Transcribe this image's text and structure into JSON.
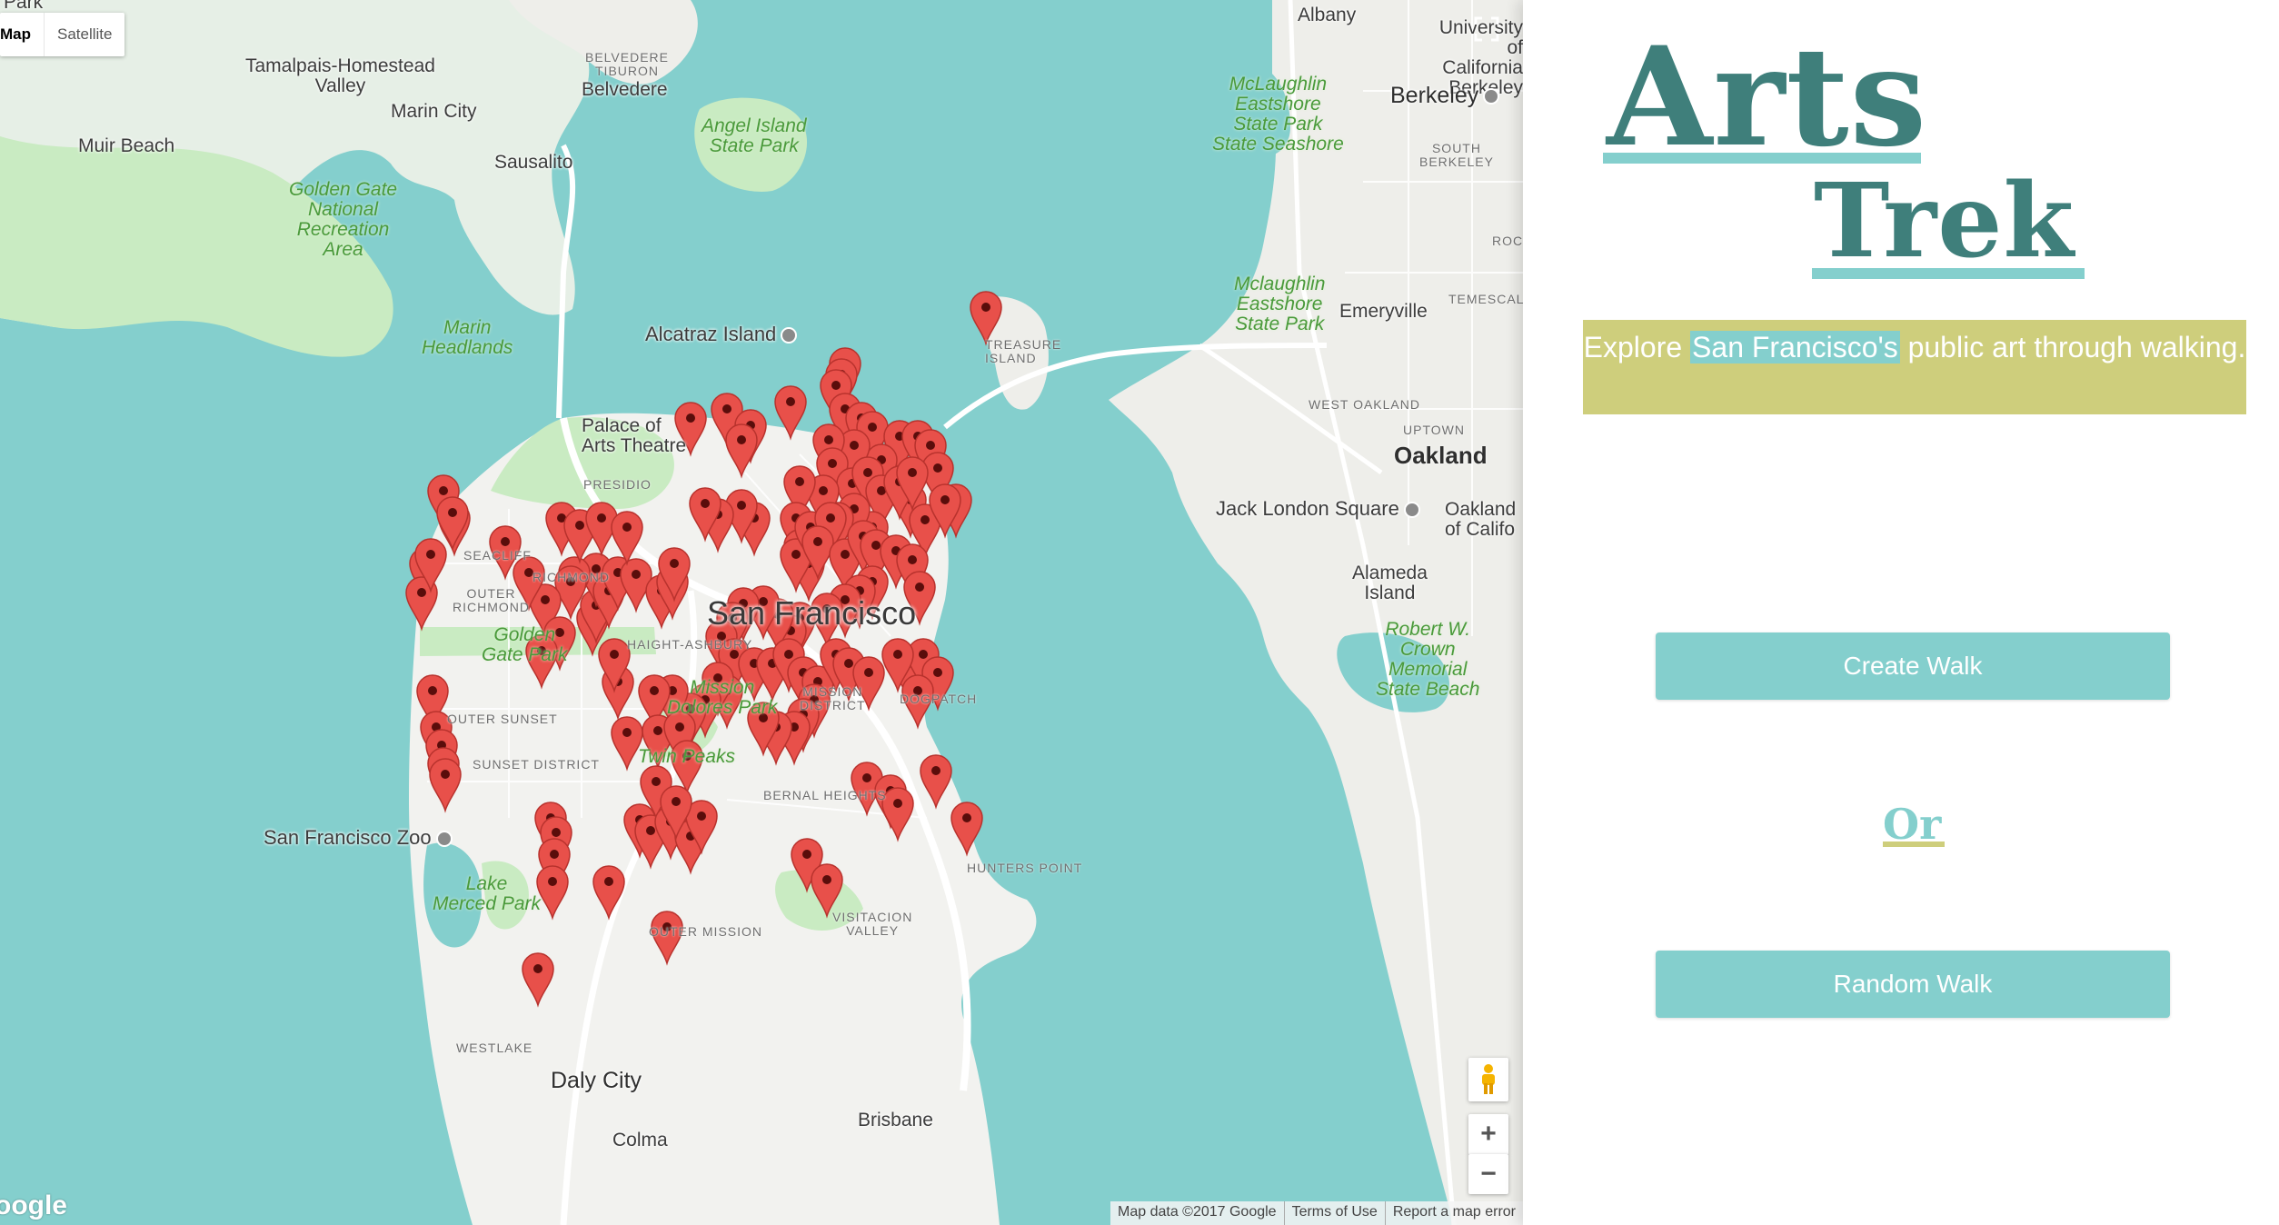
{
  "map": {
    "map_type_control": {
      "map_label": "Map",
      "satellite_label": "Satellite"
    },
    "labels": {
      "park_top": "Park",
      "tamalpais": "Tamalpais-Homestead\nValley",
      "marin_city": "Marin City",
      "muir_beach": "Muir Beach",
      "sausalito": "Sausalito",
      "belvedere_tiburon": "BELVEDERE\nTIBURON",
      "belvedere": "Belvedere",
      "angel_island": "Angel Island\nState Park",
      "golden_gate_nra": "Golden Gate\nNational\nRecreation\nArea",
      "marin_headlands": "Marin\nHeadlands",
      "alcatraz": "Alcatraz Island",
      "treasure_island": "TREASURE\nISLAND",
      "albany": "Albany",
      "university": "University of\nCalifornia\nBerkeley",
      "mclaughlin_1": "McLaughlin\nEastshore\nState Park\nState Seashore",
      "berkeley": "Berkeley",
      "south_berkeley": "SOUTH\nBERKELEY",
      "rock": "ROCK",
      "mclaughlin_2": "Mclaughlin\nEastshore\nState Park",
      "emeryville": "Emeryville",
      "temescal": "TEMESCAL",
      "west_oakland": "WEST OAKLAND",
      "uptown": "UPTOWN",
      "oakland": "Oakland",
      "jack_london": "Jack London Square",
      "oakland_univ": "Oakland\nof Califo",
      "alameda": "Alameda\nIsland",
      "robert_crown": "Robert W.\nCrown\nMemorial\nState Beach",
      "palace_of_fine_arts": "Palace of\nArts Theatre",
      "presidio": "PRESIDIO",
      "san_francisco": "San Francisco",
      "seacliff": "SEACLIFF",
      "richmond": "RICHMOND",
      "outer_richmond": "OUTER\nRICHMOND",
      "golden_gate_park": "Golden\nGate Park",
      "haight_ashbury": "HAIGHT-ASHBURY",
      "mission_dolores": "Mission\nDolores Park",
      "mission_district": "MISSION\nDISTRICT",
      "dogpatch": "DOGPATCH",
      "outer_sunset": "OUTER SUNSET",
      "sunset_district": "SUNSET DISTRICT",
      "twin_peaks": "Twin Peaks",
      "bernal_heights": "BERNAL HEIGHTS",
      "sf_zoo": "San Francisco Zoo",
      "lake_merced": "Lake\nMerced Park",
      "outer_mission": "OUTER MISSION",
      "hunters_point": "HUNTERS POINT",
      "visitacion_valley": "VISITACION\nVALLEY",
      "westlake": "WESTLAKE",
      "daly_city": "Daly City",
      "brisbane": "Brisbane",
      "colma": "Colma"
    },
    "marker_count": 146,
    "attribution": {
      "map_data": "Map data ©2017 Google",
      "terms": "Terms of Use",
      "report": "Report a map error"
    },
    "logo_text": "oogle",
    "zoom_in_label": "+",
    "zoom_out_label": "−"
  },
  "panel": {
    "title_word_1": "Arts",
    "title_word_2": "Trek",
    "tagline_before": "Explore ",
    "tagline_highlight": "San Francisco's",
    "tagline_after": " public art through walking.",
    "create_walk_label": "Create Walk",
    "or_label": "Or",
    "random_walk_label": "Random Walk"
  },
  "colors": {
    "water": "#84cfcd",
    "land": "#f2f2ef",
    "park": "#c9ebc2",
    "marker": "#e8504a",
    "brand_teal": "#3f7f7b",
    "accent_teal": "#84cfcd",
    "tagline_bg": "#cece7c"
  },
  "icons": {
    "fullscreen": "fullscreen-icon",
    "pegman": "street-view-pegman-icon",
    "marker": "map-marker-icon",
    "poi": "poi-icon"
  }
}
